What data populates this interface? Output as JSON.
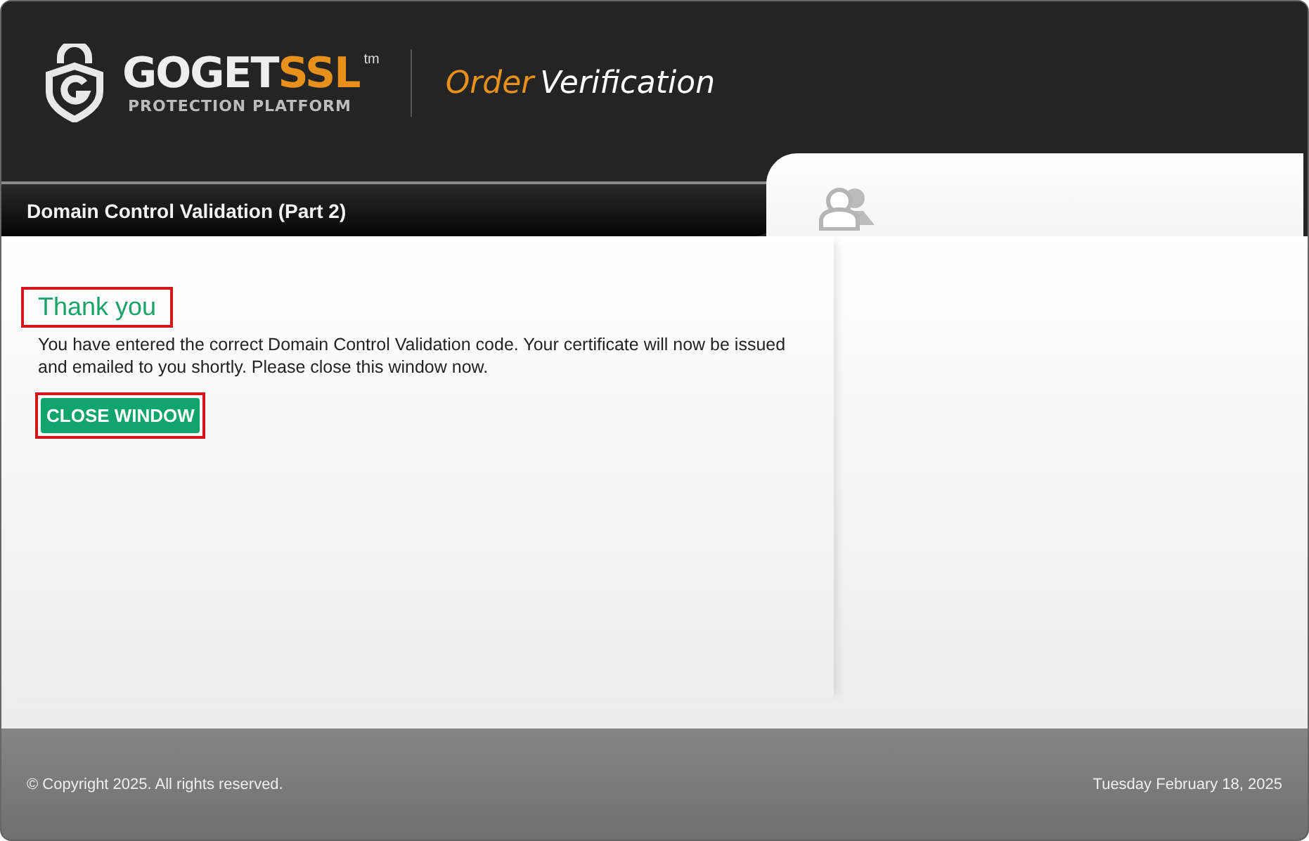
{
  "logo": {
    "brand_main": "GOGET",
    "brand_accent": "SSL",
    "trademark": "tm",
    "tagline": "PROTECTION PLATFORM"
  },
  "header": {
    "title_accent": "Order",
    "title_rest": "Verification"
  },
  "section_bar": {
    "title": "Domain Control Validation (Part 2)"
  },
  "message": {
    "heading": "Thank you",
    "heading_highlighted": true,
    "body": "You have entered the correct Domain Control Validation code. Your certificate will now be issued and emailed to you shortly. Please close this window now.",
    "button": "CLOSE WINDOW",
    "button_highlighted": true
  },
  "footer": {
    "copyright": "© Copyright 2025. All rights reserved.",
    "date": "Tuesday February 18, 2025"
  }
}
